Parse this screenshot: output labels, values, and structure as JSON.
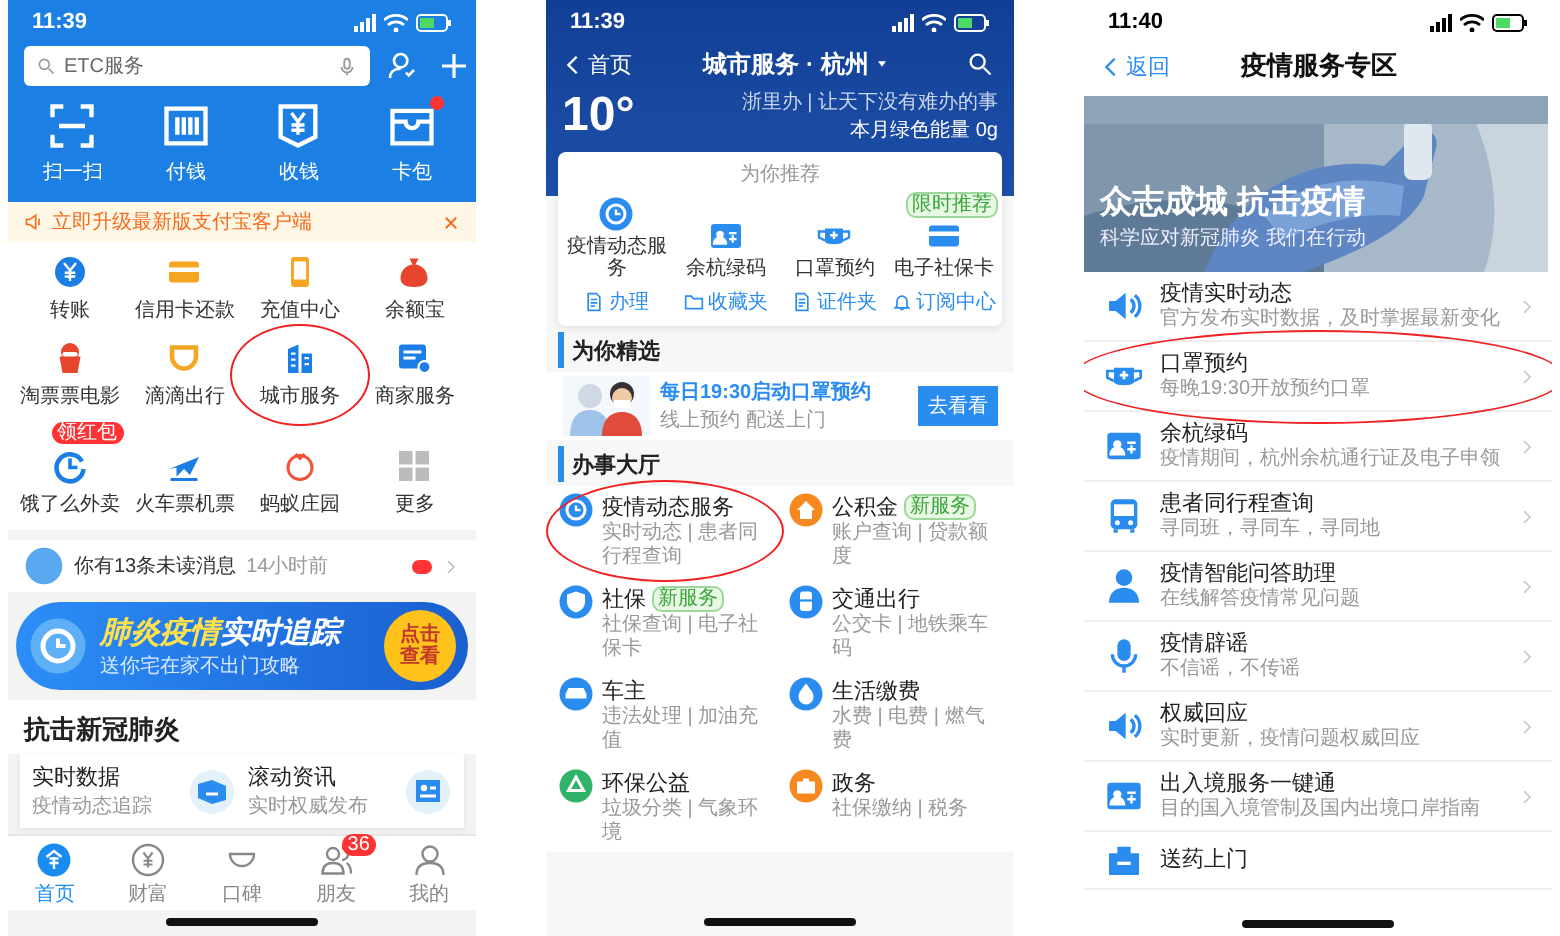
{
  "home_screen": {
    "status_time": "11:39",
    "search": {
      "placeholder": "ETC服务"
    },
    "quick_actions": [
      {
        "label": "扫一扫",
        "dot": false
      },
      {
        "label": "付钱",
        "dot": false
      },
      {
        "label": "收钱",
        "dot": false
      },
      {
        "label": "卡包",
        "dot": true
      }
    ],
    "notice": "立即升级最新版支付宝客户端",
    "apps": [
      {
        "label": "转账",
        "circled": false
      },
      {
        "label": "信用卡还款",
        "circled": false
      },
      {
        "label": "充值中心",
        "circled": false
      },
      {
        "label": "余额宝",
        "circled": false
      },
      {
        "label": "淘票票电影",
        "circled": false
      },
      {
        "label": "滴滴出行",
        "circled": false
      },
      {
        "label": "城市服务",
        "circled": true
      },
      {
        "label": "商家服务",
        "circled": false
      },
      {
        "label": "饿了么外卖",
        "circled": false,
        "badge": "领红包"
      },
      {
        "label": "火车票机票",
        "circled": false
      },
      {
        "label": "蚂蚁庄园",
        "circled": false
      },
      {
        "label": "更多",
        "circled": false
      }
    ],
    "message": {
      "text": "你有13条未读消息",
      "time": "14小时前"
    },
    "banner": {
      "title": "**肺炎疫情**实时追踪",
      "subtitle": "送你宅在家不出门攻略",
      "button": "点击查看"
    },
    "section_title": "抗击新冠肺炎",
    "cards": [
      {
        "title": "实时数据",
        "subtitle": "疫情动态追踪"
      },
      {
        "title": "滚动资讯",
        "subtitle": "实时权威发布"
      }
    ],
    "tabs": [
      {
        "label": "首页",
        "selected": true
      },
      {
        "label": "财富",
        "selected": false
      },
      {
        "label": "口碑",
        "selected": false
      },
      {
        "label": "朋友",
        "selected": false,
        "badge": "36"
      },
      {
        "label": "我的",
        "selected": false
      }
    ]
  },
  "city_service_screen": {
    "status_time": "11:39",
    "back": "首页",
    "title": "城市服务 · 杭州",
    "temperature": "10°",
    "slogan": "浙里办 | 让天下没有难办的事",
    "energy": "本月绿色能量 0g",
    "recommend_title": "为你推荐",
    "recommended": [
      {
        "label": "疫情动态服务"
      },
      {
        "label": "余杭绿码"
      },
      {
        "label": "口罩预约"
      },
      {
        "label": "电子社保卡",
        "tag": "限时推荐"
      }
    ],
    "shortcuts": [
      "办理",
      "收藏夹",
      "证件夹",
      "订阅中心"
    ],
    "picks_title": "为你精选",
    "pick": {
      "title": "每日19:30启动口罩预约",
      "subtitle": "线上预约 配送上门",
      "button": "去看看"
    },
    "hall_title": "办事大厅",
    "services": [
      {
        "title": "疫情动态服务",
        "subtitle": "实时动态 | 患者同行程查询",
        "circled": true
      },
      {
        "title": "公积金",
        "tag": "新服务",
        "subtitle": "账户查询 | 贷款额度",
        "circled": false
      },
      {
        "title": "社保",
        "tag": "新服务",
        "subtitle": "社保查询 | 电子社保卡",
        "circled": false
      },
      {
        "title": "交通出行",
        "subtitle": "公交卡 | 地铁乘车码",
        "circled": false
      },
      {
        "title": "车主",
        "subtitle": "违法处理 | 加油充值",
        "circled": false
      },
      {
        "title": "生活缴费",
        "subtitle": "水费 | 电费 | 燃气费",
        "circled": false
      },
      {
        "title": "环保公益",
        "subtitle": "垃圾分类 | 气象环境",
        "circled": false
      },
      {
        "title": "政务",
        "subtitle": "社保缴纳 | 税务",
        "circled": false
      }
    ]
  },
  "epidemic_screen": {
    "status_time": "11:40",
    "back": "返回",
    "title": "疫情服务专区",
    "hero": {
      "kind": "picture",
      "title": "众志成城 抗击疫情",
      "subtitle": "科学应对新冠肺炎 我们在行动"
    },
    "services": [
      {
        "title": "疫情实时动态",
        "subtitle": "官方发布实时数据，及时掌握最新变化",
        "circled": false
      },
      {
        "title": "口罩预约",
        "subtitle": "每晚19:30开放预约口罩",
        "circled": true
      },
      {
        "title": "余杭绿码",
        "subtitle": "疫情期间，杭州余杭通行证及电子申领",
        "circled": false
      },
      {
        "title": "患者同行程查询",
        "subtitle": "寻同班，寻同车，寻同地",
        "circled": false
      },
      {
        "title": "疫情智能问答助理",
        "subtitle": "在线解答疫情常见问题",
        "circled": false
      },
      {
        "title": "疫情辟谣",
        "subtitle": "不信谣，不传谣",
        "circled": false
      },
      {
        "title": "权威回应",
        "subtitle": "实时更新，疫情问题权威回应",
        "circled": false
      },
      {
        "title": "出入境服务一键通",
        "subtitle": "目的国入境管制及国内出境口岸指南",
        "circled": false
      },
      {
        "title": "送药上门",
        "circled": false
      }
    ]
  }
}
